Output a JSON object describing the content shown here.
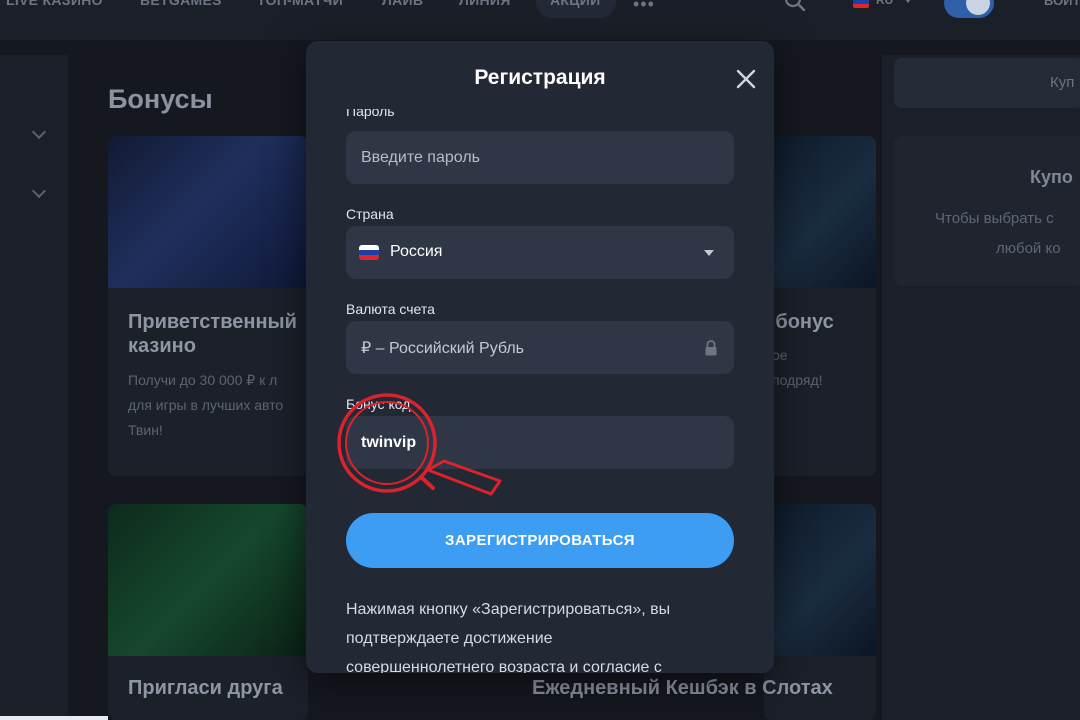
{
  "topnav": {
    "items": [
      "LIVE КАЗИНО",
      "BETGAMES",
      "ТОП-МАТЧИ",
      "ЛАЙВ",
      "ЛИНИЯ",
      "АКЦИИ"
    ],
    "more_label": "•••",
    "lang": "RU",
    "login": "ВОЙТ",
    "icons": {
      "search": "search-icon",
      "flag": "russia-flag-icon",
      "theme": "theme-toggle-icon"
    }
  },
  "page": {
    "title": "Бонусы"
  },
  "cards": [
    {
      "title_line1": "Приветственный",
      "title_line2": "казино",
      "text_line1": "Получи до 30 000 ₽ к л",
      "text_line2": "для игры в лучших авто",
      "text_line3": "Твин!"
    },
    {
      "title_line1": "т бонус",
      "text_line1": "ое",
      "text_line2": "подряд!"
    },
    {
      "title_line1": "Пригласи друга"
    },
    {
      "title_line1": "Ежедневный Кешбэк в Слотах"
    }
  ],
  "sidebar_right": {
    "tab_label": "Куп",
    "coupon_title": "Купо",
    "coupon_text1": "Чтобы выбрать с",
    "coupon_text2": "любой ко"
  },
  "modal": {
    "title": "Регистрация",
    "close_icon": "close-icon",
    "password": {
      "label": "Пароль",
      "placeholder": "Введите пароль"
    },
    "country": {
      "label": "Страна",
      "value": "Россия",
      "flag_colors": [
        "#ffffff",
        "#1c3fa8",
        "#e0262c"
      ]
    },
    "currency": {
      "label": "Валюта счета",
      "value": "₽ – Российский Рубль",
      "icon": "lock-icon"
    },
    "promo": {
      "label": "Бонус код",
      "value": "twinvip"
    },
    "submit_label": "ЗАРЕГИСТРИРОВАТЬСЯ",
    "terms_line1": "Нажимая кнопку «Зарегистрироваться», вы",
    "terms_line2": "подтверждаете достижение",
    "terms_line3": "совершеннолетнего возраста и согласие с"
  },
  "colors": {
    "accent": "#3d9df3",
    "magnifier": "#d9232d",
    "modal_bg": "#222834",
    "field_bg": "#2f3645"
  }
}
